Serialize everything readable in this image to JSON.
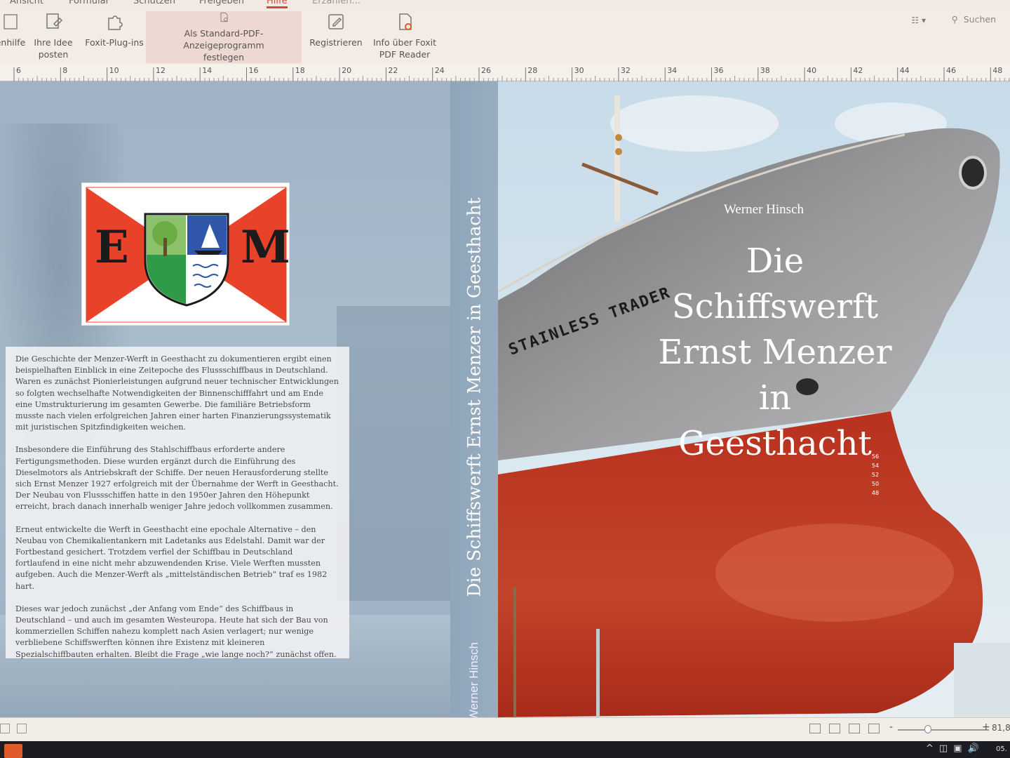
{
  "menu": {
    "tabs": [
      "Ansicht",
      "Formular",
      "Schützen",
      "Freigeben",
      "Hilfe"
    ],
    "active_tab": "Hilfe",
    "tell_me": "Erzählen..."
  },
  "ribbon": {
    "buttons": [
      {
        "label": "enhilfe",
        "icon": "help-icon"
      },
      {
        "label": "Ihre Idee\nposten",
        "icon": "idea-icon"
      },
      {
        "label": "Foxit-Plug-ins",
        "icon": "plugin-icon"
      },
      {
        "label": "Als Standard-PDF-Anzeigeprogramm\nfestlegen",
        "icon": "default-pdf-icon"
      },
      {
        "label": "Registrieren",
        "icon": "register-icon"
      },
      {
        "label": "Info über Foxit\nPDF Reader",
        "icon": "about-icon"
      }
    ],
    "search_placeholder": "Suchen"
  },
  "ruler": {
    "labels": [
      "6",
      "8",
      "10",
      "12",
      "14",
      "16",
      "18",
      "20",
      "22",
      "24",
      "26",
      "28",
      "30",
      "32",
      "34",
      "36",
      "38",
      "40",
      "42",
      "44",
      "46",
      "48"
    ]
  },
  "back_cover": {
    "logo_letters": [
      "E",
      "M"
    ],
    "paragraphs": [
      "Die Geschichte der Menzer-Werft in Geesthacht zu dokumentieren ergibt einen beispielhaften Einblick in eine Zeitepoche des Flussschiffbaus in Deutschland. Waren es zunächst Pionierleistungen aufgrund neuer technischer Entwicklungen so folgten wechselhafte Notwendigkeiten der Binnenschifffahrt und am Ende eine Umstrukturierung im gesamten Gewerbe. Die familiäre Betriebsform musste nach vielen erfolgreichen Jahren einer harten Finanzierungssystematik mit juristischen Spitzfindigkeiten weichen.",
      "Insbesondere die Einführung des Stahlschiffbaus erforderte andere Fertigungsmethoden. Diese wurden ergänzt durch die Einführung des Dieselmotors als Antriebskraft der Schiffe. Der neuen Herausforderung stellte sich Ernst Menzer 1927 erfolgreich mit der Übernahme der Werft in Geesthacht. Der Neubau von Flussschiffen hatte in den 1950er Jahren den Höhepunkt erreicht, brach danach innerhalb weniger Jahre jedoch vollkommen zusammen.",
      "Erneut entwickelte die Werft in Geesthacht eine epochale Alternative – den Neubau von Chemikalientankern mit Ladetanks aus Edelstahl. Damit war der Fortbestand gesichert. Trotzdem verfiel der Schiffbau in Deutschland fortlaufend in eine nicht mehr abzuwendenden Krise. Viele Werften mussten aufgeben. Auch die Menzer-Werft als „mittelständischen Betrieb“ traf es 1982 hart.",
      "Dieses war jedoch zunächst „der Anfang vom Ende“ des Schiffbaus in Deutschland – und auch im gesamten Westeuropa. Heute hat sich der Bau von kommerziellen Schiffen nahezu komplett nach Asien verlagert; nur wenige verbliebene Schiffswerften können ihre Existenz mit kleineren Spezialschiffbauten erhalten. Bleibt die Frage „wie lange noch?“ zunächst offen."
    ]
  },
  "spine": {
    "title": "Die Schiffswerft Ernst Menzer in Geesthacht",
    "author": "Werner Hinsch"
  },
  "front_cover": {
    "author": "Werner Hinsch",
    "title_lines": [
      "Die Schiffswerft",
      "Ernst Menzer in",
      "Geesthacht"
    ],
    "ship_name": "STAINLESS TRADER",
    "draft_marks": [
      "56",
      "54",
      "52",
      "50",
      "48"
    ]
  },
  "statusbar": {
    "zoom_minus": "-",
    "zoom_plus": "+",
    "zoom": "81,8",
    "zoom_fraction": 0.33
  },
  "taskbar": {
    "clock_tail": "05."
  },
  "colors": {
    "accent": "#d9473a",
    "hull_red": "#b8321f",
    "hull_grey": "#8f8f90",
    "cover_blue": "#a3b6c7",
    "logo_red": "#e8432a"
  }
}
